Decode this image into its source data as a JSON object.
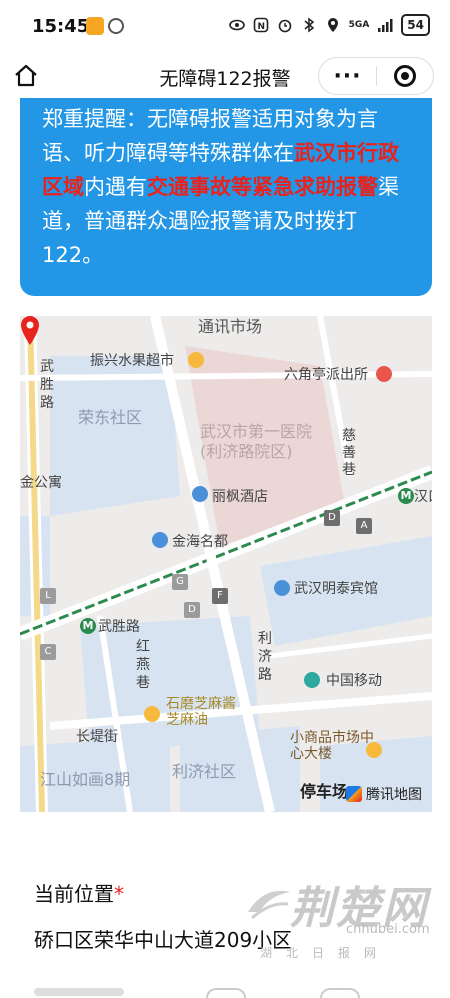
{
  "status_bar": {
    "time": "15:45",
    "signal_text": "5GA",
    "battery": "54"
  },
  "nav": {
    "title": "无障碍122报警",
    "more_label": "···"
  },
  "notice": {
    "part1": "郑重提醒：无障碍报警适用对象为言语、听力障碍等特殊群体在",
    "highlight1": "武汉市行政区域",
    "part2": "内遇有",
    "highlight2": "交通事故等紧急求助报警",
    "part3": "渠道，普通群众遇险报警请及时拨打122。",
    "highlight_color": "#e8221c",
    "background_color": "#2396e6"
  },
  "map": {
    "labels": {
      "tongxun": "通讯市场",
      "wusheng_road_v": "武胜路",
      "zhenxing": "振兴水果超市",
      "liujiaoting": "六角亭派出所",
      "rongdong": "荣东社区",
      "hospital": "武汉市第一医院(利济路院区)",
      "cishan": "慈善巷",
      "jingongyu": "金公寓",
      "lifeng": "丽枫酒店",
      "hankou": "汉口",
      "jinhai": "金海名都",
      "mingtai": "武汉明泰宾馆",
      "wusheng_metro": "武胜路",
      "liji_road": "利济路",
      "hongyan": "红燕巷",
      "china_mobile": "中国移动",
      "shimo": "石磨芝麻酱芝麻油",
      "changdi": "长堤街",
      "xiaoshangpin": "小商品市场中心大楼",
      "jiangshan": "江山如画8期",
      "liji_community": "利济社区",
      "parking": "停车场",
      "logo": "腾讯地图"
    },
    "exits": [
      "D",
      "A",
      "G",
      "D",
      "F",
      "L",
      "C"
    ],
    "metro_letter": "M"
  },
  "location": {
    "label": "当前位置",
    "required_mark": "*",
    "value": "硚口区荣华中山大道209小区"
  },
  "watermark": {
    "brand": "荆楚网",
    "url": "cnhubei.com",
    "sub": "湖北日报网"
  }
}
